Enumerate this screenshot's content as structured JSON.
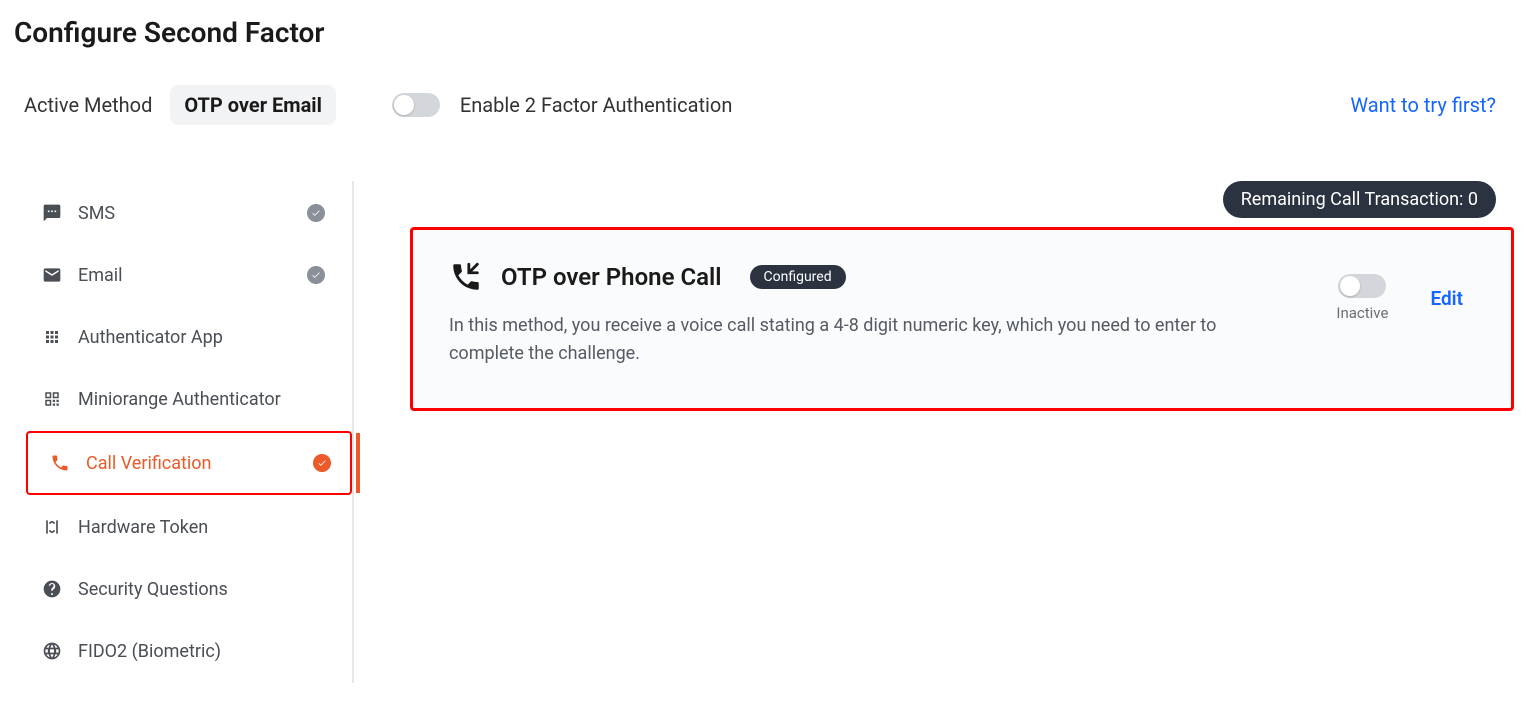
{
  "page_title": "Configure Second Factor",
  "active_method": {
    "label": "Active Method",
    "value": "OTP over Email"
  },
  "enable_2fa": {
    "label": "Enable 2 Factor Authentication",
    "on": false
  },
  "try_first_link": "Want to try first?",
  "sidebar": {
    "items": [
      {
        "label": "SMS",
        "icon": "sms-icon",
        "checked": "gray"
      },
      {
        "label": "Email",
        "icon": "email-icon",
        "checked": "gray"
      },
      {
        "label": "Authenticator App",
        "icon": "grid-icon",
        "checked": null
      },
      {
        "label": "Miniorange Authenticator",
        "icon": "qr-icon",
        "checked": null
      },
      {
        "label": "Call Verification",
        "icon": "phone-icon",
        "checked": "orange",
        "active": true
      },
      {
        "label": "Hardware Token",
        "icon": "signal-icon",
        "checked": null
      },
      {
        "label": "Security Questions",
        "icon": "question-icon",
        "checked": null
      },
      {
        "label": "FIDO2 (Biometric)",
        "icon": "globe-icon",
        "checked": null
      }
    ]
  },
  "remaining_pill": "Remaining Call Transaction: 0",
  "card": {
    "title": "OTP over Phone Call",
    "badge": "Configured",
    "description": "In this method, you receive a voice call stating a 4-8 digit numeric key, which you need to enter to complete the challenge.",
    "status_label": "Inactive",
    "edit_label": "Edit"
  }
}
